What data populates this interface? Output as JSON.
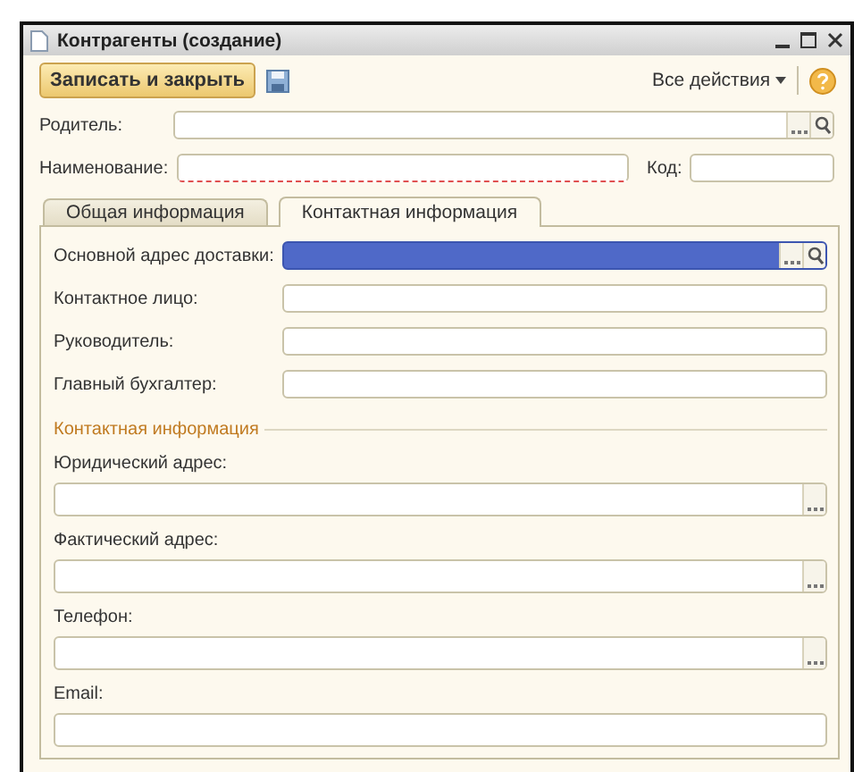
{
  "window": {
    "title": "Контрагенты (создание)"
  },
  "toolbar": {
    "save_close_button": "Записать и закрыть",
    "all_actions": "Все действия"
  },
  "parent_field": {
    "label": "Родитель:",
    "kind": "select",
    "required": false
  },
  "name_field": {
    "label": "Наименование:",
    "required": true
  },
  "code_field": {
    "label": "Код:",
    "required": false
  },
  "tabs": [
    {
      "label": "Общая информация",
      "selected": false
    },
    {
      "label": "Контактная информация",
      "selected": true
    }
  ],
  "contact_fields": [
    {
      "label": "Основной адрес доставки:",
      "kind": "select",
      "focused": true
    },
    {
      "label": "Контактное лицо:",
      "kind": "text",
      "focused": false
    },
    {
      "label": "Руководитель:",
      "kind": "text",
      "focused": false
    },
    {
      "label": "Главный бухгалтер:",
      "kind": "text",
      "focused": false
    }
  ],
  "contact_group": {
    "title": "Контактная информация",
    "fields": [
      {
        "label": "Юридический адрес:",
        "kind": "choice",
        "focused": false
      },
      {
        "label": "Фактический адрес:",
        "kind": "choice",
        "focused": false
      },
      {
        "label": "Телефон:",
        "kind": "choice",
        "focused": false
      },
      {
        "label": "Email:",
        "kind": "text",
        "focused": false
      }
    ]
  }
}
